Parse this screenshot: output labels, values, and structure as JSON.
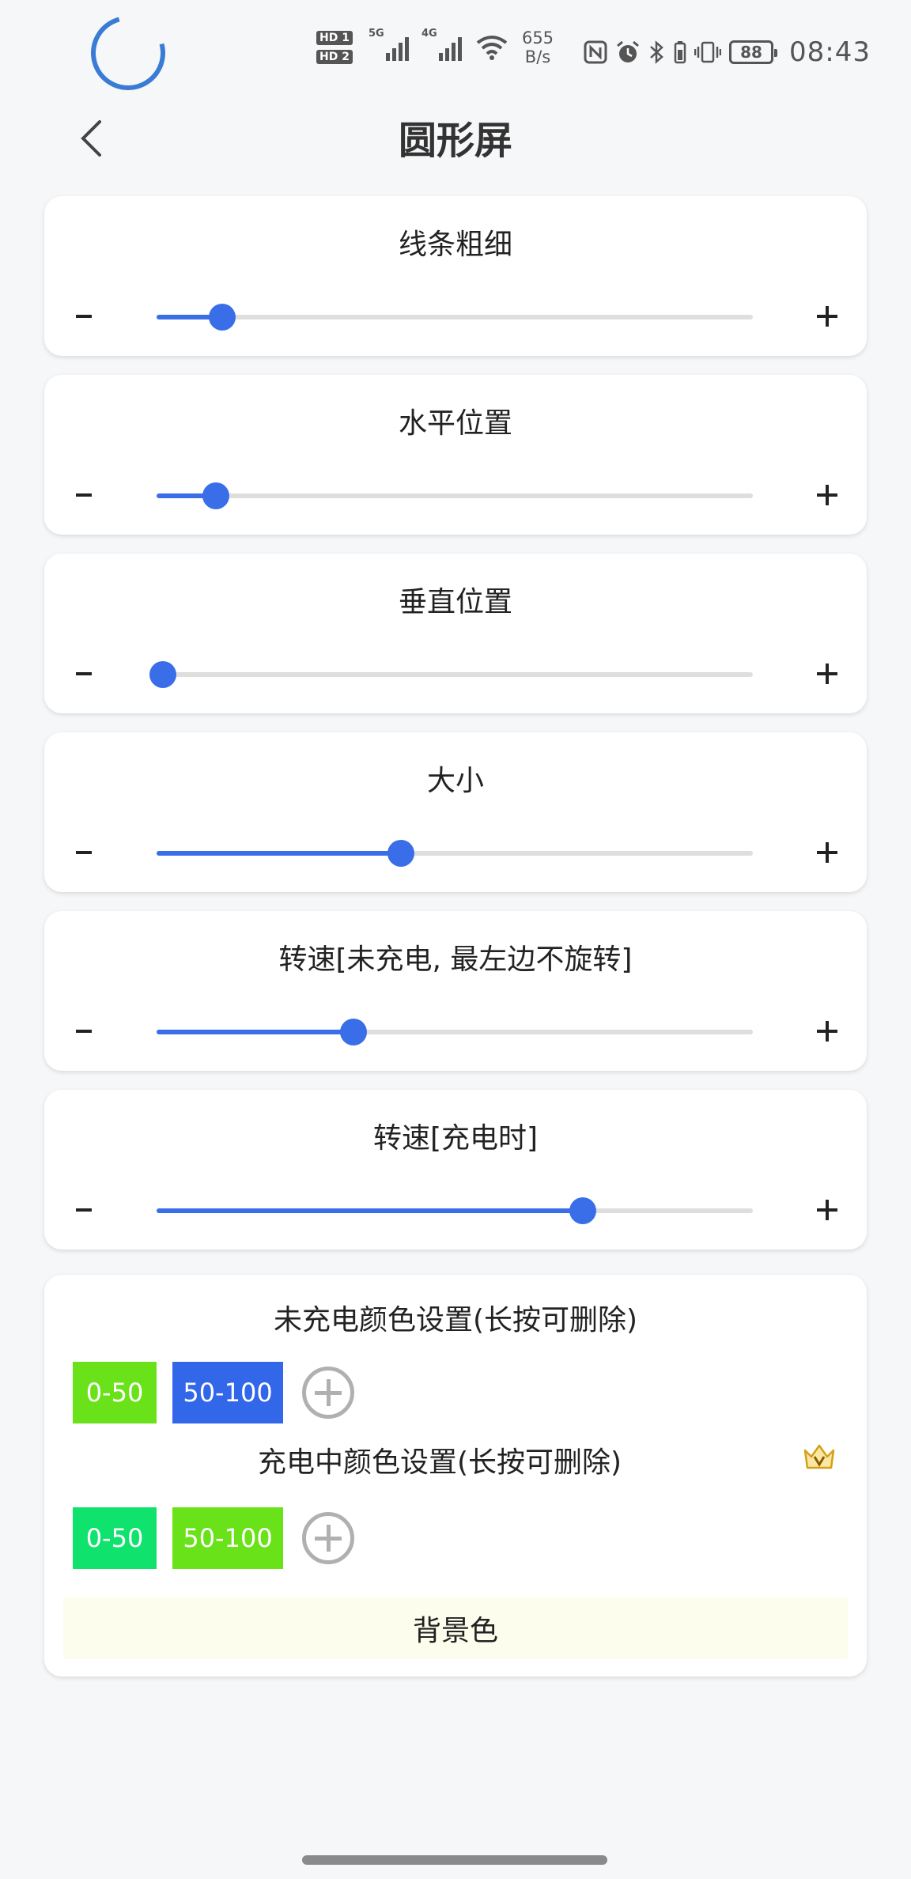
{
  "status_bar": {
    "hd1": "HD 1",
    "hd2": "HD 2",
    "sig1": "5G",
    "sig2": "4G",
    "speed_value": "655",
    "speed_unit": "B/s",
    "battery": "88",
    "time": "08:43"
  },
  "header": {
    "title": "圆形屏"
  },
  "sliders": [
    {
      "label": "线条粗细",
      "value": 0.11
    },
    {
      "label": "水平位置",
      "value": 0.1
    },
    {
      "label": "垂直位置",
      "value": 0.01
    },
    {
      "label": "大小",
      "value": 0.41
    },
    {
      "label": "转速[未充电, 最左边不旋转]",
      "value": 0.33
    },
    {
      "label": "转速[充电时]",
      "value": 0.715
    }
  ],
  "colors": {
    "uncharged_title": "未充电颜色设置(长按可删除)",
    "uncharged_chips": [
      {
        "label": "0-50",
        "color": "#6ae21a"
      },
      {
        "label": "50-100",
        "color": "#3367ea"
      }
    ],
    "charging_title": "充电中颜色设置(长按可删除)",
    "charging_chips": [
      {
        "label": "0-50",
        "color": "#10e36d"
      },
      {
        "label": "50-100",
        "color": "#6ae21a"
      }
    ],
    "background_label": "背景色"
  },
  "accent_color": "#3a6ee8"
}
